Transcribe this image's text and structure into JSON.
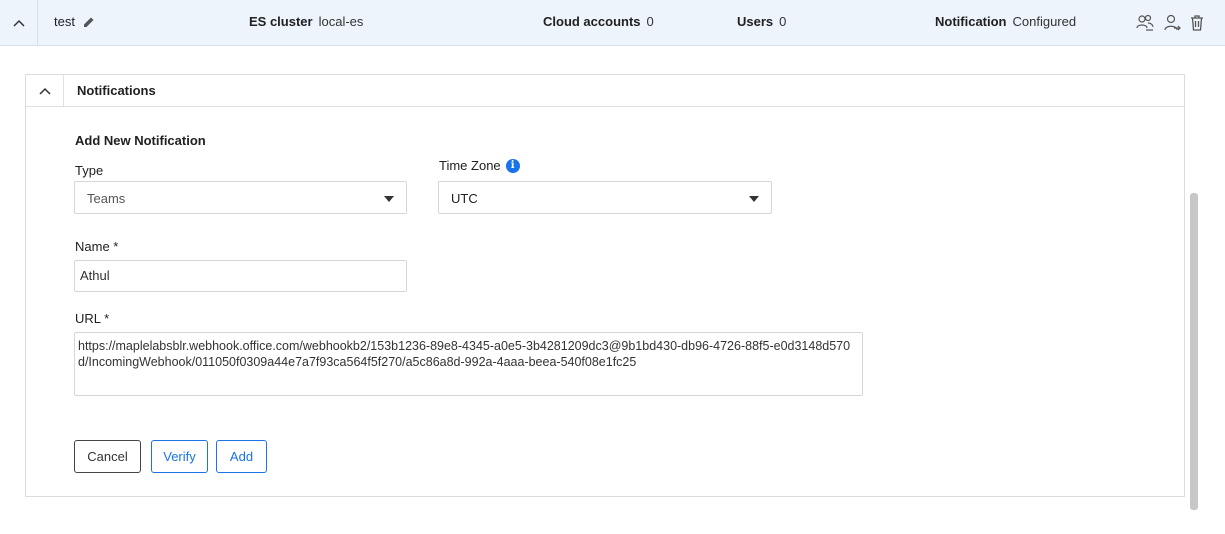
{
  "topbar": {
    "name": "test",
    "es_cluster_label": "ES cluster",
    "es_cluster_value": "local-es",
    "cloud_accounts_label": "Cloud accounts",
    "cloud_accounts_value": "0",
    "users_label": "Users",
    "users_value": "0",
    "notification_label": "Notification",
    "notification_value": "Configured",
    "icons": [
      "collapse-icon",
      "edit-icon",
      "users-icon",
      "user-access-icon",
      "delete-icon"
    ]
  },
  "panel": {
    "title": "Notifications"
  },
  "form": {
    "section_title": "Add New Notification",
    "type_label": "Type",
    "type_value": "Teams",
    "timezone_label": "Time Zone",
    "timezone_value": "UTC",
    "name_label": "Name *",
    "name_value": "Athul",
    "url_label": "URL *",
    "url_value": "https://maplelabsblr.webhook.office.com/webhookb2/153b1236-89e8-4345-a0e5-3b4281209dc3@9b1bd430-db96-4726-88f5-e0d3148d570d/IncomingWebhook/011050f0309a44e7a7f93ca564f5f270/a5c86a8d-992a-4aaa-beea-540f08e1fc25"
  },
  "buttons": {
    "cancel": "Cancel",
    "verify": "Verify",
    "add": "Add"
  },
  "colors": {
    "accent": "#1a73e8",
    "topbar_bg": "#eef4fb"
  }
}
